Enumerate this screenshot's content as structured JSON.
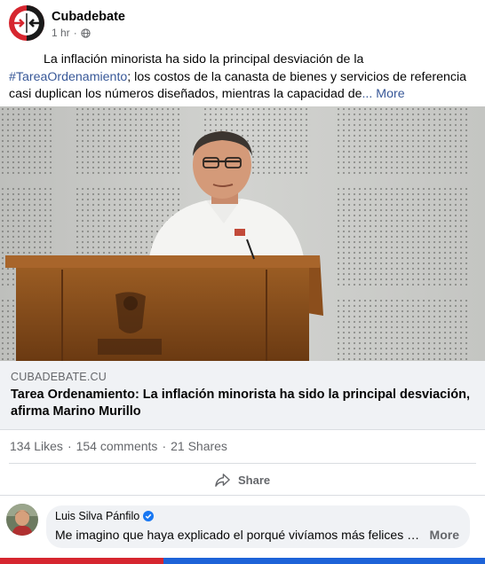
{
  "post": {
    "page_name": "Cubadebate",
    "time": "1 hr",
    "caption_text": "La inflación minorista ha sido la principal desviación de la",
    "hashtag": "#TareaOrdenamiento",
    "caption_rest": "; los costos de la canasta de bienes y servicios de referencia casi duplican los números diseñados, mientras la capacidad de",
    "ellipsis": "...",
    "more_label": "More"
  },
  "link_preview": {
    "domain": "CUBADEBATE.CU",
    "title": "Tarea Ordenamiento: La inflación minorista ha sido la principal desviación, afirma Marino Murillo"
  },
  "stats": {
    "likes": "134 Likes",
    "sep1": "·",
    "comments": "154 comments",
    "sep2": "·",
    "shares": "21 Shares"
  },
  "actions": {
    "share_label": "Share"
  },
  "comment": {
    "author": "Luis Silva Pánfilo",
    "text": "Me imagino que haya explicado el porqué vivíamos más felices …",
    "more_label": "More"
  },
  "colors": {
    "brand_red": "#d6262f",
    "link_blue": "#385898",
    "verified_blue": "#1877f2"
  }
}
